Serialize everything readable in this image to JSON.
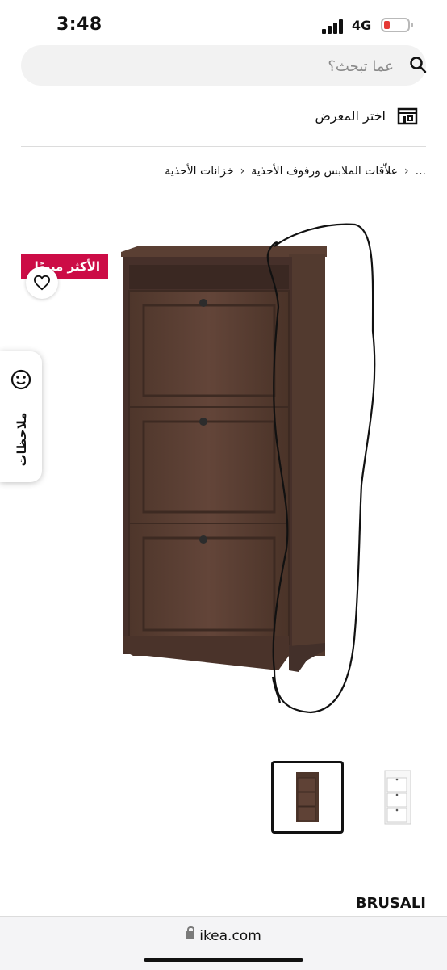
{
  "status": {
    "time": "3:48",
    "network": "4G"
  },
  "search": {
    "placeholder": "عما تبحث؟"
  },
  "store": {
    "label": "اختر المعرض"
  },
  "breadcrumb": {
    "ellipsis": "...",
    "items": [
      "علاّقات الملابس ورفوف الأحذية",
      "خزانات الأحذية"
    ]
  },
  "product": {
    "badge": "الأكثر مبيعًا",
    "feedback_label": "ملاحظات",
    "name": "BRUSALI",
    "thumbnails": [
      "brown-variant",
      "white-variant"
    ]
  },
  "browser": {
    "url": "ikea.com"
  },
  "colors": {
    "badge": "#cc0c46",
    "cabinet": "#5a3f33",
    "scribble": "#111111"
  }
}
